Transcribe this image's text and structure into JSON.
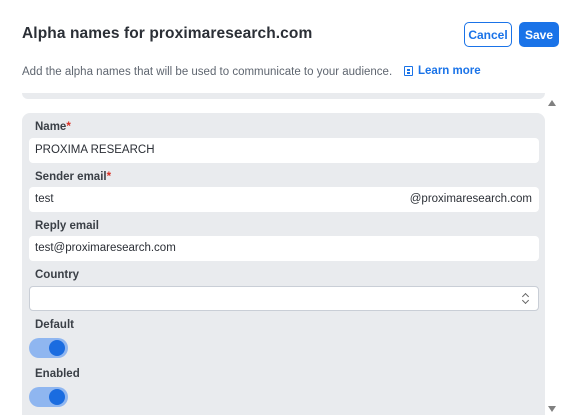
{
  "dialog": {
    "title": "Alpha names for proximaresearch.com",
    "cancel_label": "Cancel",
    "save_label": "Save",
    "subtitle": "Add the alpha names that will be used to communicate to your audience.",
    "learn_more_label": "Learn more"
  },
  "form": {
    "name": {
      "label": "Name",
      "required_mark": "*",
      "value": "PROXIMA RESEARCH"
    },
    "sender_email": {
      "label": "Sender email",
      "required_mark": "*",
      "value": "test",
      "domain_suffix": "@proximaresearch.com"
    },
    "reply_email": {
      "label": "Reply email",
      "value": "test@proximaresearch.com"
    },
    "country": {
      "label": "Country",
      "value": ""
    },
    "default": {
      "label": "Default",
      "on": true
    },
    "enabled": {
      "label": "Enabled",
      "on": true
    }
  },
  "colors": {
    "accent": "#1a73e8",
    "required": "#d93025",
    "panel_bg": "#e9ebee"
  },
  "icons": {
    "learn_more": "book-icon",
    "select": "chevron-updown-icon",
    "scroll_up": "triangle-up-icon",
    "scroll_down": "triangle-down-icon"
  }
}
